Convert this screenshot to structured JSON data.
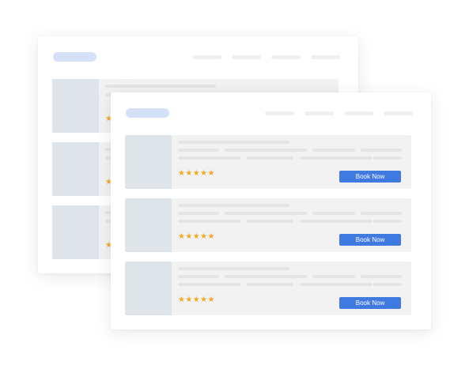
{
  "colors": {
    "accent": "#3f7ae0",
    "star": "#f5a623",
    "logo_pill": "#d5e1f7"
  },
  "icons": {
    "star": "star-icon"
  },
  "listings": [
    {
      "stars": "★★★★★",
      "rating": 5,
      "book_label": "Book Now"
    },
    {
      "stars": "★★★★★",
      "rating": 5,
      "book_label": "Book Now"
    },
    {
      "stars": "★★★★★",
      "rating": 5,
      "book_label": "Book Now"
    }
  ],
  "back_listings": [
    {
      "stars": "★",
      "rating": 5
    },
    {
      "stars": "★",
      "rating": 5
    },
    {
      "stars": "★",
      "rating": 5
    }
  ]
}
